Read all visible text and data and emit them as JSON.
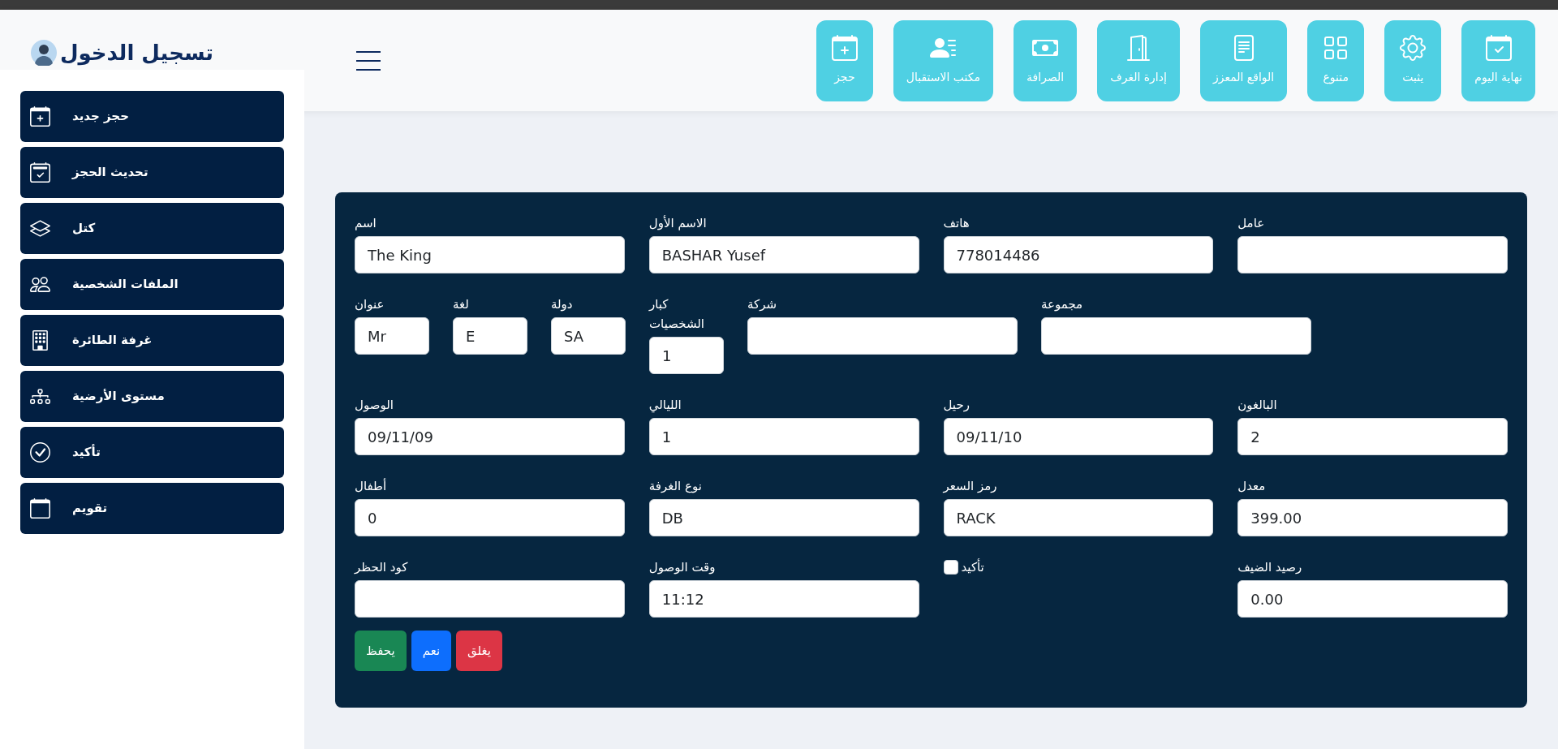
{
  "header": {
    "title": "تسجيل الدخول"
  },
  "toolbar": [
    {
      "label": "نهاية اليوم"
    },
    {
      "label": "يثبت"
    },
    {
      "label": "متنوع"
    },
    {
      "label": "الواقع المعزز"
    },
    {
      "label": "إدارة الغرف"
    },
    {
      "label": "الصرافة"
    },
    {
      "label": "مكتب الاستقبال"
    },
    {
      "label": "حجز"
    }
  ],
  "sidebar": {
    "items": [
      {
        "label": "حجز جديد"
      },
      {
        "label": "تحديث الحجز"
      },
      {
        "label": "كتل"
      },
      {
        "label": "الملفات الشخصية"
      },
      {
        "label": "غرفة الطائرة"
      },
      {
        "label": "مستوى الأرضية"
      },
      {
        "label": "تأكيد"
      },
      {
        "label": "تقويم"
      }
    ]
  },
  "form": {
    "rows": [
      {
        "fields": [
          {
            "kind": "text",
            "label": "عامل"
          },
          {
            "kind": "text",
            "label": "هاتف",
            "value": "778014486"
          },
          {
            "kind": "text",
            "label": "الاسم الأول",
            "value": "BASHAR Yusef"
          },
          {
            "kind": "text",
            "label": "اسم",
            "value": "The King"
          }
        ]
      },
      {
        "fields": [
          {
            "kind": "text",
            "label": "مجموعة"
          },
          {
            "kind": "text",
            "label": "شركة"
          },
          {
            "kind": "short",
            "label": "كبار الشخصيات",
            "value": "1"
          },
          {
            "kind": "short",
            "label": "دولة",
            "value": "SA"
          },
          {
            "kind": "short",
            "label": "لغة",
            "value": "E"
          },
          {
            "kind": "short",
            "label": "عنوان",
            "value": "Mr"
          }
        ]
      },
      {
        "fields": [
          {
            "kind": "text",
            "label": "البالغون",
            "value": "2"
          },
          {
            "kind": "text",
            "label": "رحيل",
            "value": "09/11/10"
          },
          {
            "kind": "text",
            "label": "الليالي",
            "value": "1"
          },
          {
            "kind": "text",
            "label": "الوصول",
            "value": "09/11/09"
          }
        ]
      },
      {
        "fields": [
          {
            "kind": "text",
            "label": "معدل",
            "value": "399.00"
          },
          {
            "kind": "text",
            "label": "رمز السعر",
            "value": "RACK"
          },
          {
            "kind": "text",
            "label": "نوع الغرفة",
            "value": "DB"
          },
          {
            "kind": "text",
            "label": "أطفال",
            "value": "0"
          }
        ]
      },
      {
        "fields": [
          {
            "kind": "text",
            "label": "رصيد الضيف",
            "value": "0.00"
          },
          {
            "kind": "checkbox",
            "label": "تأكيد",
            "checked": false
          },
          {
            "kind": "text",
            "label": "وقت الوصول",
            "value": "11:12"
          },
          {
            "kind": "text",
            "label": "كود الحظر"
          }
        ]
      }
    ],
    "buttons": [
      {
        "label": "يغلق",
        "color": "#dc3545"
      },
      {
        "label": "نعم",
        "color": "#0d6efd"
      },
      {
        "label": "يحفظ",
        "color": "#198754"
      }
    ]
  }
}
